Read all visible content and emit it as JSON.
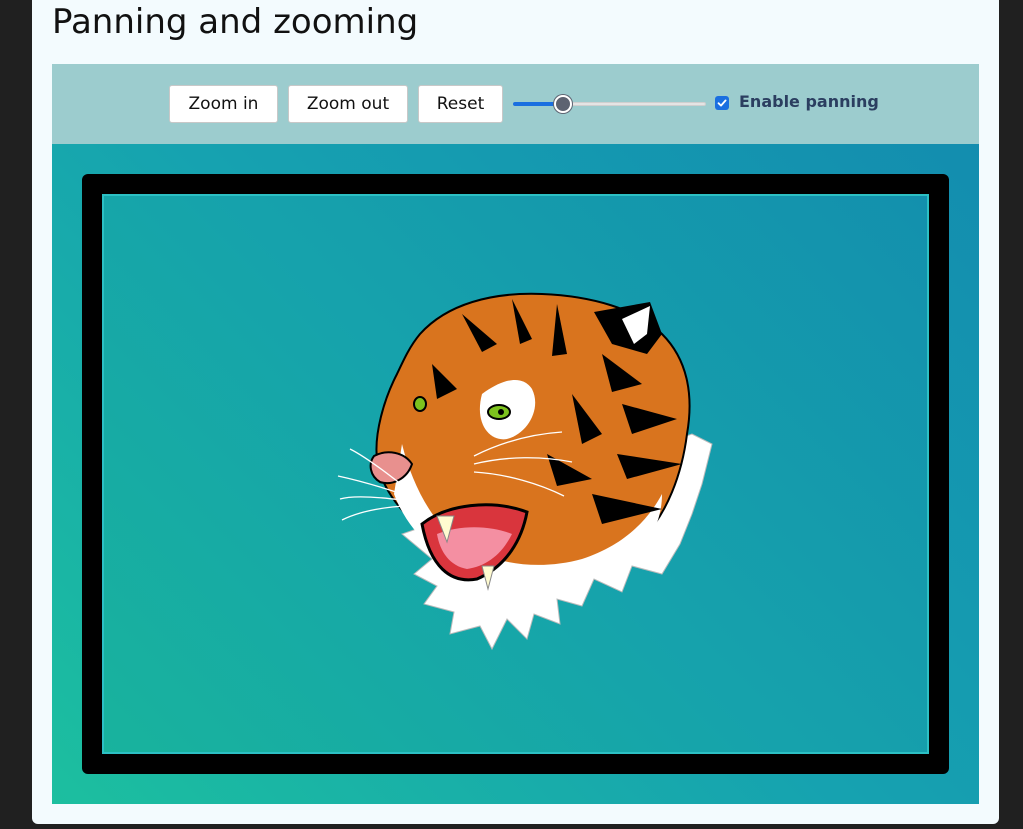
{
  "page": {
    "title": "Panning and zooming"
  },
  "toolbar": {
    "zoom_in_label": "Zoom in",
    "zoom_out_label": "Zoom out",
    "reset_label": "Reset",
    "zoom_slider_fraction": 0.26,
    "enable_panning_label": "Enable panning",
    "enable_panning_checked": true
  },
  "colors": {
    "toolbar_bg": "#9cccce",
    "accent": "#1a6fe0",
    "stage_gradient": [
      "#1cbf9f",
      "#138daf"
    ]
  },
  "image": {
    "icon": "tiger-head-image"
  }
}
